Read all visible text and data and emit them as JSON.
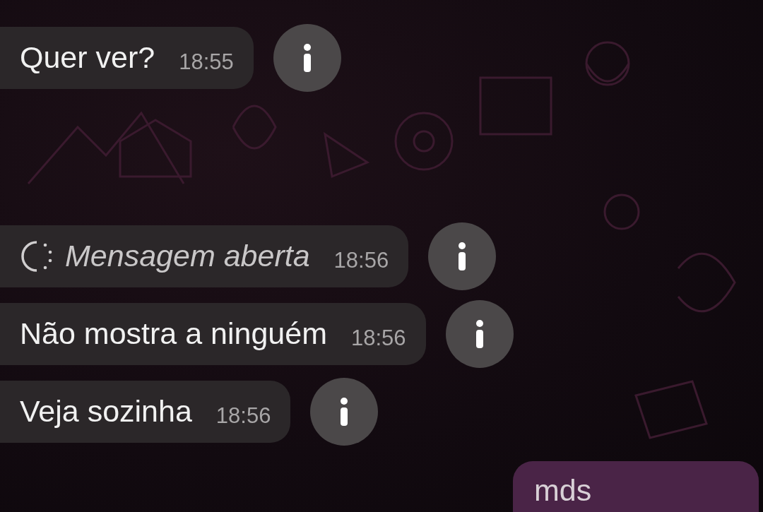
{
  "messages": [
    {
      "kind": "received",
      "text": "Quer ver?",
      "time": "18:55"
    },
    {
      "kind": "opened",
      "text": "Mensagem aberta",
      "time": "18:56"
    },
    {
      "kind": "received",
      "text": "Não mostra a ninguém",
      "time": "18:56"
    },
    {
      "kind": "received",
      "text": "Veja sozinha",
      "time": "18:56"
    },
    {
      "kind": "sent",
      "text": "mds"
    }
  ]
}
